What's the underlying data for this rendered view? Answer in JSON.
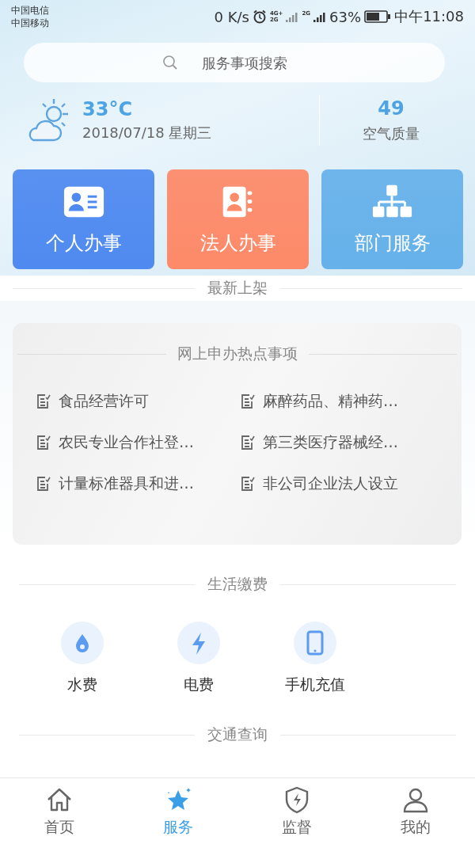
{
  "status_bar": {
    "carriers": [
      "中国电信",
      "中国移动"
    ],
    "speed": "0 K/s",
    "network_1": "4G+",
    "network_1b": "2G",
    "network_2": "2G",
    "battery": "63%",
    "time": "中午11:08"
  },
  "search": {
    "placeholder": "服务事项搜索"
  },
  "weather": {
    "temperature": "33°C",
    "date": "2018/07/18 星期三",
    "aqi": "49",
    "aqi_label": "空气质量"
  },
  "tiles": [
    {
      "label": "个人办事",
      "kind": "id-card",
      "color": "#4f8af0"
    },
    {
      "label": "法人办事",
      "kind": "contact-book",
      "color": "#fd8a69"
    },
    {
      "label": "部门服务",
      "kind": "org",
      "color": "#66b1ea"
    }
  ],
  "latest": {
    "title": "最新上架"
  },
  "hot": {
    "title": "网上申办热点事项",
    "items": [
      "食品经营许可",
      "麻醉药品、精神药…",
      "农民专业合作社登…",
      "第三类医疗器械经…",
      "计量标准器具和进…",
      "非公司企业法人设立"
    ]
  },
  "payments": {
    "title": "生活缴费",
    "items": [
      {
        "label": "水费",
        "kind": "water"
      },
      {
        "label": "电费",
        "kind": "power"
      },
      {
        "label": "手机充值",
        "kind": "phone"
      }
    ]
  },
  "traffic": {
    "title": "交通查询"
  },
  "tab_bar": [
    {
      "label": "首页",
      "kind": "home",
      "selected": false
    },
    {
      "label": "服务",
      "kind": "star",
      "selected": true
    },
    {
      "label": "监督",
      "kind": "shield",
      "selected": false
    },
    {
      "label": "我的",
      "kind": "user",
      "selected": false
    }
  ]
}
